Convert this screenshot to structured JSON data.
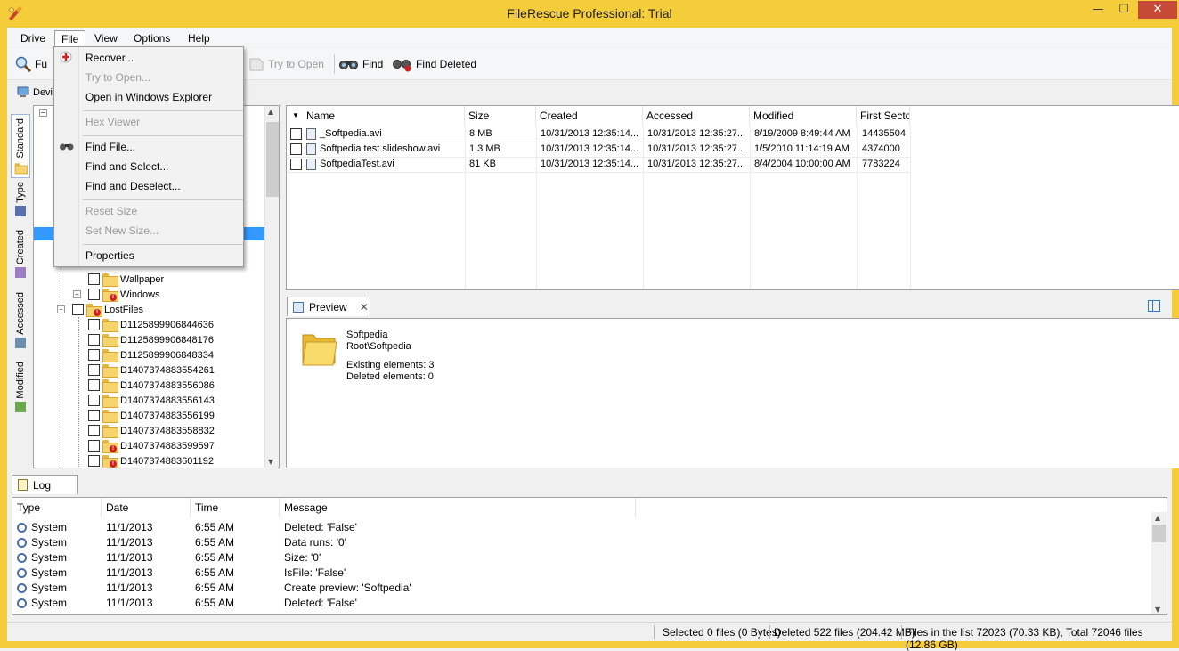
{
  "window": {
    "title": "FileRescue Professional: Trial",
    "minimize": "—",
    "maximize": "☐",
    "close": "✕"
  },
  "menubar": [
    {
      "label": "Drive"
    },
    {
      "label": "File"
    },
    {
      "label": "View"
    },
    {
      "label": "Options"
    },
    {
      "label": "Help"
    }
  ],
  "toolbar": {
    "full_partial": "Fu",
    "try_open": "Try to Open",
    "find": "Find",
    "find_deleted": "Find Deleted",
    "device_partial": "Devi"
  },
  "file_menu": {
    "items": [
      {
        "label": "Recover...",
        "enabled": true
      },
      {
        "label": "Try to Open...",
        "enabled": false
      },
      {
        "label": "Open in Windows Explorer",
        "enabled": true
      },
      {
        "label": "Hex Viewer",
        "enabled": false
      },
      {
        "label": "Find File...",
        "enabled": true
      },
      {
        "label": "Find and Select...",
        "enabled": true
      },
      {
        "label": "Find and Deselect...",
        "enabled": true
      },
      {
        "label": "Reset Size",
        "enabled": false
      },
      {
        "label": "Set New Size...",
        "enabled": false
      },
      {
        "label": "Properties",
        "enabled": true
      }
    ]
  },
  "vtabs": [
    "Standard",
    "Type",
    "Created",
    "Accessed",
    "Modified"
  ],
  "tree": {
    "items": [
      {
        "label": "Wallpaper",
        "indent": 2,
        "error": false
      },
      {
        "label": "Windows",
        "indent": 2,
        "error": true,
        "expander": "+"
      },
      {
        "label": "LostFiles",
        "indent": 1,
        "error": true,
        "expander": "−"
      },
      {
        "label": "D1125899906844636",
        "indent": 2,
        "error": false
      },
      {
        "label": "D1125899906848176",
        "indent": 2,
        "error": false
      },
      {
        "label": "D1125899906848334",
        "indent": 2,
        "error": false
      },
      {
        "label": "D1407374883554261",
        "indent": 2,
        "error": false
      },
      {
        "label": "D1407374883556086",
        "indent": 2,
        "error": false
      },
      {
        "label": "D1407374883556143",
        "indent": 2,
        "error": false
      },
      {
        "label": "D1407374883556199",
        "indent": 2,
        "error": false
      },
      {
        "label": "D1407374883558832",
        "indent": 2,
        "error": false
      },
      {
        "label": "D1407374883599597",
        "indent": 2,
        "error": true
      },
      {
        "label": "D1407374883601192",
        "indent": 2,
        "error": true
      }
    ]
  },
  "filelist": {
    "columns": [
      "Name",
      "Size",
      "Created",
      "Accessed",
      "Modified",
      "First Sector"
    ],
    "rows": [
      {
        "name": "_Softpedia.avi",
        "size": "8 MB",
        "created": "10/31/2013  12:35:14...",
        "accessed": "10/31/2013  12:35:27...",
        "modified": "8/19/2009 8:49:44 AM",
        "sector": "14435504"
      },
      {
        "name": "Softpedia test slideshow.avi",
        "size": "1.3 MB",
        "created": "10/31/2013  12:35:14...",
        "accessed": "10/31/2013  12:35:27...",
        "modified": "1/5/2010 11:14:19 AM",
        "sector": "4374000"
      },
      {
        "name": "SoftpediaTest.avi",
        "size": "81 KB",
        "created": "10/31/2013  12:35:14...",
        "accessed": "10/31/2013  12:35:27...",
        "modified": "8/4/2004 10:00:00 AM",
        "sector": "7783224"
      }
    ]
  },
  "preview": {
    "tab_label": "Preview",
    "name": "Softpedia",
    "path": "Root\\Softpedia",
    "existing": "Existing elements: 3",
    "deleted": "Deleted elements: 0"
  },
  "log": {
    "tab_label": "Log",
    "columns": [
      "Type",
      "Date",
      "Time",
      "Message"
    ],
    "rows": [
      {
        "type": "System",
        "date": "11/1/2013",
        "time": "6:55 AM",
        "message": "Deleted: 'False'"
      },
      {
        "type": "System",
        "date": "11/1/2013",
        "time": "6:55 AM",
        "message": "Data runs: '0'"
      },
      {
        "type": "System",
        "date": "11/1/2013",
        "time": "6:55 AM",
        "message": "Size: '0'"
      },
      {
        "type": "System",
        "date": "11/1/2013",
        "time": "6:55 AM",
        "message": "IsFile: 'False'"
      },
      {
        "type": "System",
        "date": "11/1/2013",
        "time": "6:55 AM",
        "message": "Create preview: 'Softpedia'"
      },
      {
        "type": "System",
        "date": "11/1/2013",
        "time": "6:55 AM",
        "message": "Deleted: 'False'"
      }
    ]
  },
  "statusbar": {
    "selected": "Selected 0 files (0 Bytes)",
    "deleted": "Deleted 522 files (204.42 MB)",
    "total": "Files in the list 72023 (70.33 KB), Total 72046 files (12.86 GB)"
  },
  "colors": {
    "frame": "#f5cc3a",
    "selection": "#3399ff",
    "error_badge": "#d02020"
  }
}
